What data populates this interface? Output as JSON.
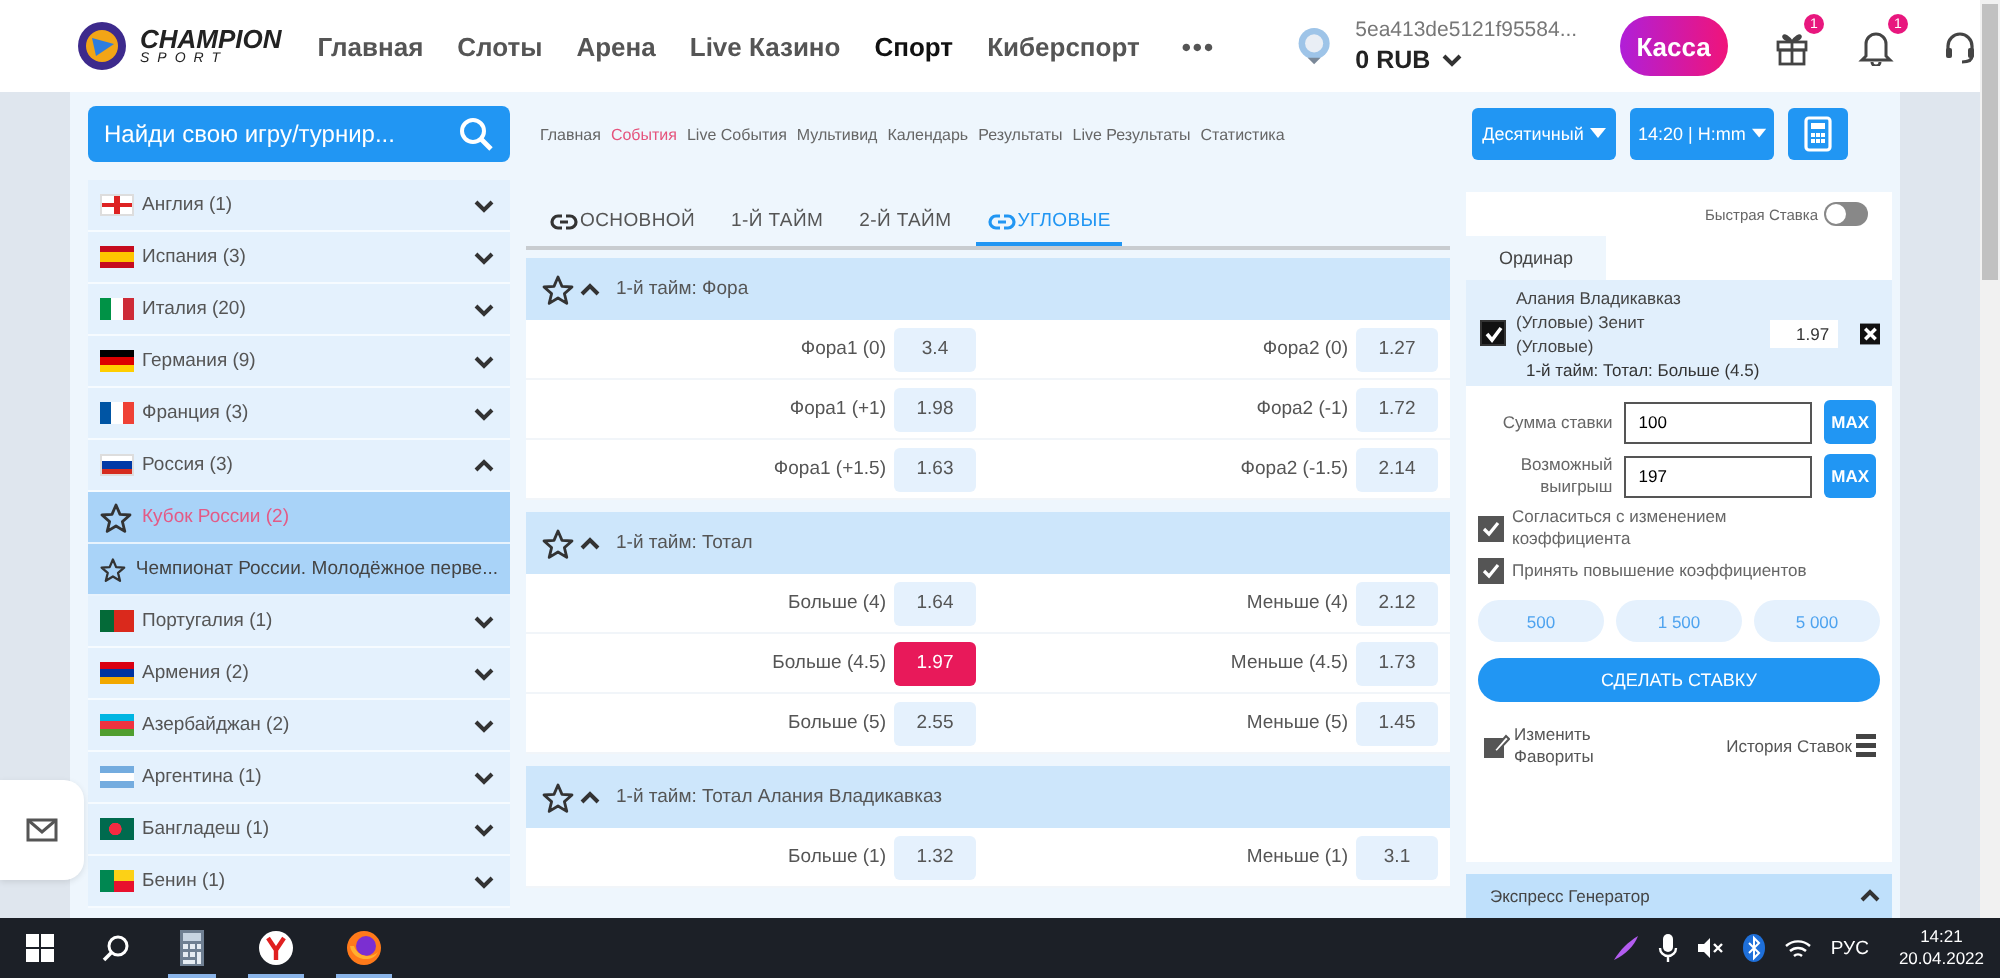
{
  "header": {
    "logo": {
      "title": "CHAMPION",
      "subtitle": "SPORT"
    },
    "nav": [
      {
        "label": "Главная",
        "selected": false
      },
      {
        "label": "Слоты",
        "selected": false
      },
      {
        "label": "Арена",
        "selected": false
      },
      {
        "label": "Live Казино",
        "selected": false
      },
      {
        "label": "Спорт",
        "selected": true
      },
      {
        "label": "Киберспорт",
        "selected": false
      }
    ],
    "more": "•••",
    "account": {
      "id": "5ea413de5121f95584...",
      "balance": "0 RUB"
    },
    "cashier": "Касса",
    "icons": [
      {
        "kind": "gift",
        "badge": "1"
      },
      {
        "kind": "bell",
        "badge": "1"
      },
      {
        "kind": "headset"
      }
    ]
  },
  "subheader": {
    "search": {
      "placeholder": "Найди свою игру/турнир..."
    },
    "links": [
      {
        "label": "Главная",
        "selected": false
      },
      {
        "label": "События",
        "selected": true
      },
      {
        "label": "Live События",
        "selected": false
      },
      {
        "label": "Мультивид",
        "selected": false
      },
      {
        "label": "Календарь",
        "selected": false
      },
      {
        "label": "Результаты",
        "selected": false
      },
      {
        "label": "Live Результаты",
        "selected": false
      },
      {
        "label": "Статистика",
        "selected": false
      }
    ],
    "odds_format": "Десятичный",
    "time_format": "14:20 | H:mm"
  },
  "sidebar": {
    "countries": [
      {
        "name": "Англия (1)",
        "kind": "england",
        "expanded": false
      },
      {
        "name": "Испания (3)",
        "kind": "spain",
        "expanded": false
      },
      {
        "name": "Италия (20)",
        "kind": "italy",
        "expanded": false
      },
      {
        "name": "Германия (9)",
        "kind": "germany",
        "expanded": false
      },
      {
        "name": "Франция (3)",
        "kind": "france",
        "expanded": false
      },
      {
        "name": "Россия (3)",
        "kind": "russia",
        "expanded": true,
        "children": [
          {
            "name": "Кубок России (2)",
            "selected": true
          },
          {
            "name": "Чемпионат России. Молодёжное перве...",
            "selected": false
          }
        ]
      },
      {
        "name": "Португалия (1)",
        "kind": "portugal",
        "expanded": false
      },
      {
        "name": "Армения (2)",
        "kind": "armenia",
        "expanded": false
      },
      {
        "name": "Азербайджан (2)",
        "kind": "azerbaijan",
        "expanded": false
      },
      {
        "name": "Аргентина (1)",
        "kind": "argentina",
        "expanded": false
      },
      {
        "name": "Бангладеш (1)",
        "kind": "bangladesh",
        "expanded": false
      },
      {
        "name": "Бенин (1)",
        "kind": "benin",
        "expanded": false
      }
    ]
  },
  "main": {
    "tabs": [
      {
        "label": "ОСНОВНОЙ",
        "linked": true,
        "selected": false
      },
      {
        "label": "1-Й ТАЙМ",
        "linked": false,
        "selected": false
      },
      {
        "label": "2-Й ТАЙМ",
        "linked": false,
        "selected": false
      },
      {
        "label": "УГЛОВЫЕ",
        "linked": true,
        "selected": true
      }
    ],
    "markets": [
      {
        "title": "1-й тайм: Фора",
        "expanded": true,
        "rows": [
          [
            {
              "label": "Фора1 (0)",
              "odd": "3.4",
              "selected": false
            },
            {
              "label": "Фора2 (0)",
              "odd": "1.27",
              "selected": false
            }
          ],
          [
            {
              "label": "Фора1 (+1)",
              "odd": "1.98",
              "selected": false
            },
            {
              "label": "Фора2 (-1)",
              "odd": "1.72",
              "selected": false
            }
          ],
          [
            {
              "label": "Фора1 (+1.5)",
              "odd": "1.63",
              "selected": false
            },
            {
              "label": "Фора2 (-1.5)",
              "odd": "2.14",
              "selected": false
            }
          ]
        ]
      },
      {
        "title": "1-й тайм: Тотал",
        "expanded": true,
        "rows": [
          [
            {
              "label": "Больше (4)",
              "odd": "1.64",
              "selected": false
            },
            {
              "label": "Меньше (4)",
              "odd": "2.12",
              "selected": false
            }
          ],
          [
            {
              "label": "Больше (4.5)",
              "odd": "1.97",
              "selected": true
            },
            {
              "label": "Меньше (4.5)",
              "odd": "1.73",
              "selected": false
            }
          ],
          [
            {
              "label": "Больше (5)",
              "odd": "2.55",
              "selected": false
            },
            {
              "label": "Меньше (5)",
              "odd": "1.45",
              "selected": false
            }
          ]
        ]
      },
      {
        "title": "1-й тайм: Тотал Алания Владикавказ",
        "expanded": true,
        "rows": [
          [
            {
              "label": "Больше (1)",
              "odd": "1.32",
              "selected": false
            },
            {
              "label": "Меньше (1)",
              "odd": "3.1",
              "selected": false
            }
          ]
        ]
      }
    ]
  },
  "betslip": {
    "quick_bet": {
      "label": "Быстрая Ставка",
      "on": false
    },
    "tabs": [
      {
        "label": "Ординар",
        "selected": true
      }
    ],
    "selection": {
      "checked": true,
      "event": "Алания Владикавказ (Угловые) Зенит (Угловые)",
      "odd": "1.97",
      "market": "1-й тайм: Тотал: Больше (4.5)"
    },
    "stake": {
      "label": "Сумма ставки",
      "value": "100",
      "max": "MAX"
    },
    "payout": {
      "label": "Возможный выигрыш",
      "value": "197",
      "max": "MAX"
    },
    "options": [
      {
        "label": "Согласиться с изменением коэффициента",
        "checked": true
      },
      {
        "label": "Принять повышение коэффициентов",
        "checked": true
      }
    ],
    "quick_amounts": [
      "500",
      "1 500",
      "5 000"
    ],
    "submit": "СДЕЛАТЬ СТАВКУ",
    "edit_favorites": "Изменить Фавориты",
    "history": "История Ставок",
    "express": {
      "title": "Экспресс Генератор",
      "expanded": true
    }
  },
  "taskbar": {
    "language": "РУС",
    "time": "14:21",
    "date": "20.04.2022"
  }
}
